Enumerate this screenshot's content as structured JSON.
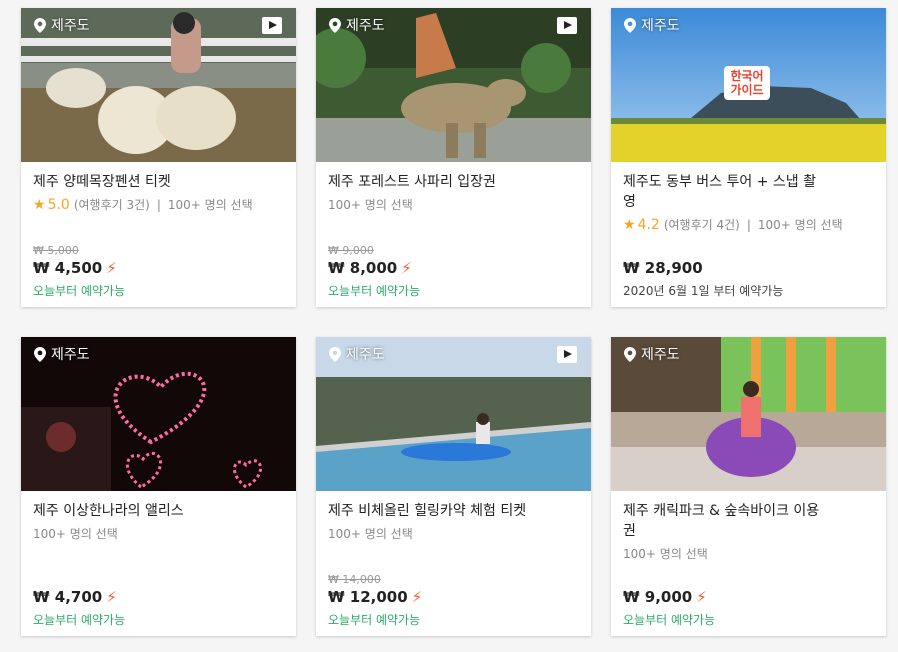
{
  "cards": [
    {
      "location": "제주도",
      "has_video": true,
      "title": "제주 양떼목장펜션 티켓",
      "rating": "5.0",
      "reviews": "(여행후기 3건)",
      "bookings": "100+ 명의 선택",
      "original_price": "₩ 5,000",
      "price": "₩ 4,500",
      "instant": "⚡",
      "availability": "오늘부터 예약가능"
    },
    {
      "location": "제주도",
      "has_video": true,
      "title": "제주 포레스트 사파리 입장권",
      "bookings": "100+ 명의 선택",
      "original_price": "₩ 9,000",
      "price": "₩ 8,000",
      "instant": "⚡",
      "availability": "오늘부터 예약가능"
    },
    {
      "location": "제주도",
      "has_video": false,
      "image_badge": "한국어\n가이드",
      "title": "제주도 동부 버스 투어 + 스냅 촬영",
      "rating": "4.2",
      "reviews": "(여행후기 4건)",
      "bookings": "100+ 명의 선택",
      "price": "₩ 28,900",
      "availability": "2020년 6월 1일 부터 예약가능"
    },
    {
      "location": "제주도",
      "has_video": false,
      "title": "제주 이상한나라의 앨리스",
      "bookings": "100+ 명의 선택",
      "price": "₩ 4,700",
      "instant": "⚡",
      "availability": "오늘부터 예약가능"
    },
    {
      "location": "제주도",
      "has_video": true,
      "title": "제주 비체올린 힐링카약 체험 티켓",
      "bookings": "100+ 명의 선택",
      "original_price": "₩ 14,000",
      "price": "₩ 12,000",
      "instant": "⚡",
      "availability": "오늘부터 예약가능"
    },
    {
      "location": "제주도",
      "has_video": false,
      "title": "제주 캐릭파크 & 숲속바이크 이용권",
      "bookings": "100+ 명의 선택",
      "price": "₩ 9,000",
      "instant": "⚡",
      "availability": "오늘부터 예약가능"
    }
  ],
  "colors": {
    "accent_green": "#2eaa6a",
    "star": "#f5a623",
    "instant_bolt": "#ff5a2c"
  },
  "icons": {
    "location": "map-pin-icon",
    "video": "play-icon",
    "rating": "star-icon",
    "instant": "lightning-icon"
  }
}
